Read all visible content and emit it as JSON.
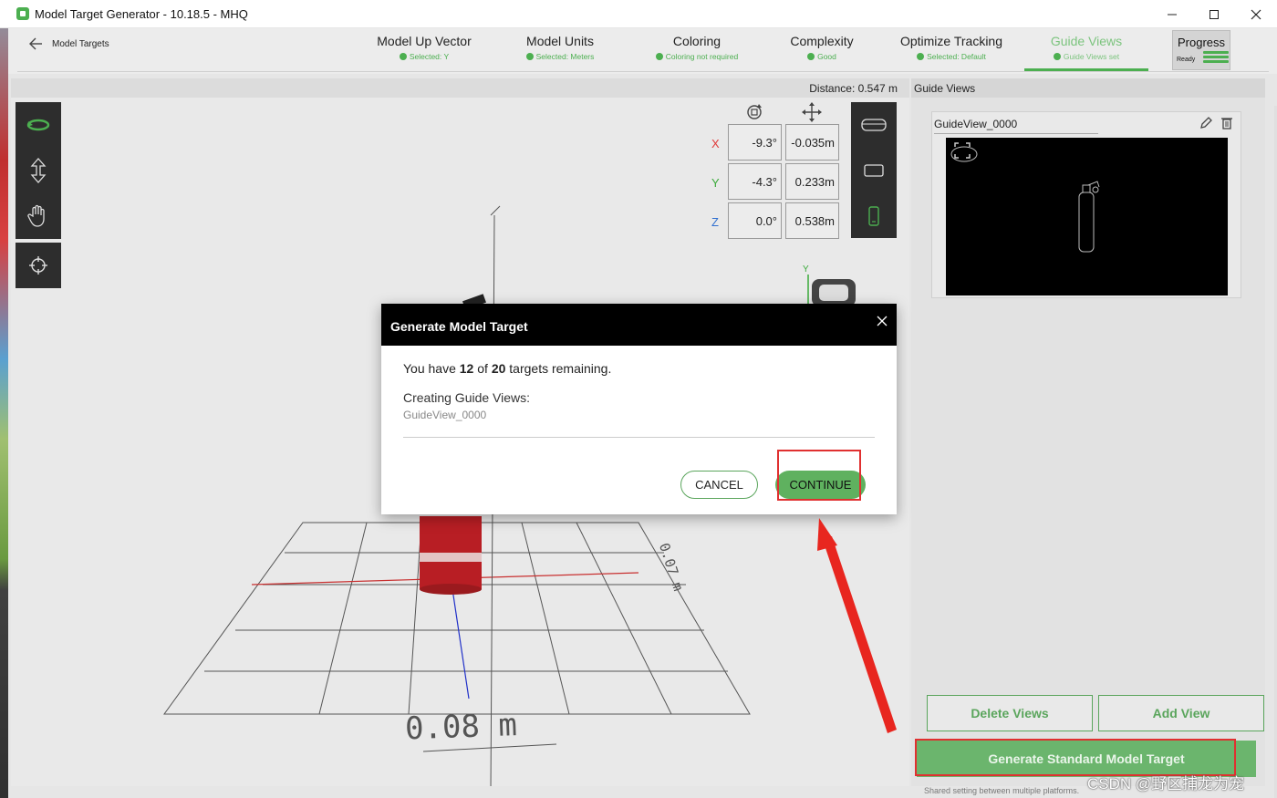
{
  "window": {
    "title": "Model Target Generator - 10.18.5 - MHQ",
    "minimize": "—",
    "maximize": "☐",
    "close": "✕"
  },
  "header": {
    "back_label": "Model Targets",
    "steps": [
      {
        "label": "Model Up Vector",
        "sub": "Selected: Y"
      },
      {
        "label": "Model Units",
        "sub": "Selected: Meters"
      },
      {
        "label": "Coloring",
        "sub": "Coloring not required"
      },
      {
        "label": "Complexity",
        "sub": "Good"
      },
      {
        "label": "Optimize Tracking",
        "sub": "Selected: Default"
      },
      {
        "label": "Guide Views",
        "sub": "Guide Views set"
      }
    ],
    "progress": {
      "label": "Progress",
      "status": "Ready"
    }
  },
  "viewport": {
    "distance_label": "Distance:",
    "distance_value": "0.547 m",
    "pose": {
      "x": {
        "axis": "X",
        "rotation": "-9.3°",
        "position": "-0.035m"
      },
      "y": {
        "axis": "Y",
        "rotation": "-4.3°",
        "position": "0.233m"
      },
      "z": {
        "axis": "Z",
        "rotation": "0.0°",
        "position": "0.538m"
      }
    },
    "grid_label_front": "0.08 m",
    "grid_label_side": "0.07 m",
    "gizmo_axis": "Y",
    "colors": {
      "x_axis": "#e03a3a",
      "y_axis": "#3aaa3a",
      "z_axis": "#2f6fd0"
    }
  },
  "panel": {
    "title": "Guide Views",
    "guide_view_name": "GuideView_0000",
    "delete_views": "Delete Views",
    "add_view": "Add View",
    "generate": "Generate Standard Model Target",
    "shared_note": "Shared setting between multiple platforms."
  },
  "modal": {
    "title": "Generate Model Target",
    "close": "✕",
    "remaining_prefix": "You have ",
    "remaining_count": "12",
    "remaining_of": " of ",
    "remaining_total": "20",
    "remaining_suffix": " targets remaining.",
    "creating_label": "Creating Guide Views:",
    "creating_name": "GuideView_0000",
    "cancel": "CANCEL",
    "continue": "CONTINUE"
  },
  "watermark": "CSDN @野区捕龙为宠",
  "accent_color": "#4caf50"
}
